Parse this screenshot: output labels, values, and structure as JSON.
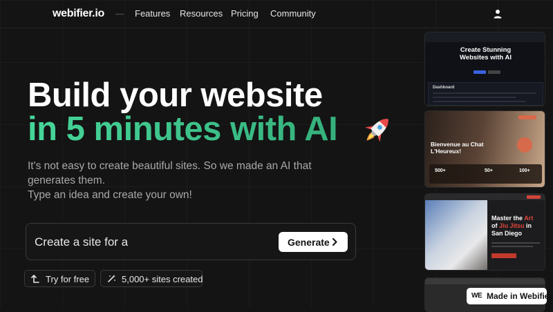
{
  "nav": {
    "logo": "webifier.io",
    "links": [
      "Features",
      "Resources",
      "Pricing",
      "Community"
    ]
  },
  "hero": {
    "line1": "Build your website",
    "line2": "in 5 minutes with AI",
    "subtitle_1": "It's not easy to create beautiful sites. So we made an AI that generates them.",
    "subtitle_2": "Type an idea and create your own!"
  },
  "prompt": {
    "value": "Create a site for a",
    "generate_label": "Generate"
  },
  "pills": {
    "try_label": "Try for free",
    "sites_label": "5,000+ sites created"
  },
  "thumbnails": {
    "t1": {
      "heading_1": "Create Stunning",
      "heading_2": "Websites with AI",
      "section": "Dashboard"
    },
    "t2": {
      "heading_1": "Bienvenue au Chat",
      "heading_2": "L'Heureux!",
      "stats": [
        {
          "value": "500+"
        },
        {
          "value": "50+"
        },
        {
          "value": "100+"
        }
      ]
    },
    "t3": {
      "heading_1": "Master the",
      "heading_accent": "Art",
      "heading_2": "of",
      "heading_accent_2": "Jiu Jitsu",
      "heading_3": "in",
      "heading_4": "San Diego"
    }
  },
  "badge": {
    "we": "WE",
    "label": "Made in Webifier"
  },
  "colors": {
    "background": "#141414",
    "accent_green": "#3fcf8e",
    "jiu_jitsu_red": "#e0453a"
  }
}
